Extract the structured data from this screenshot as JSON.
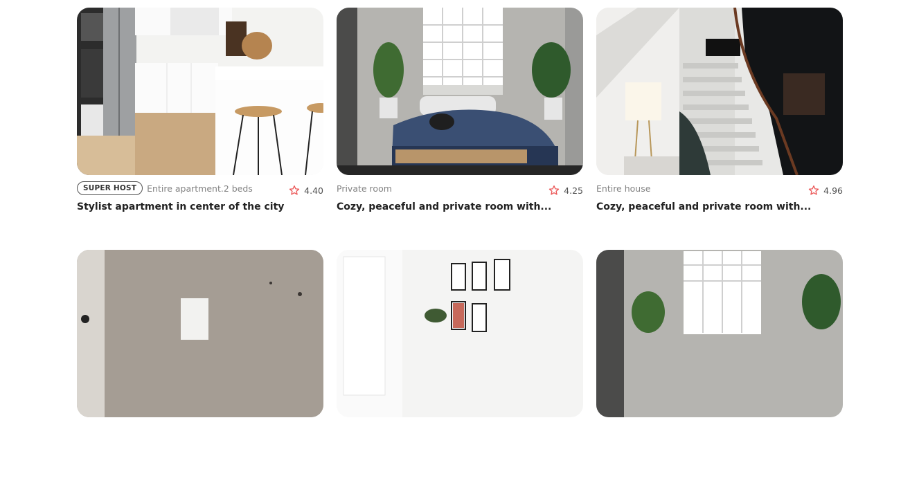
{
  "listings": [
    {
      "badge": "SUPER HOST",
      "type": "Entire apartment.2 beds",
      "rating": "4.40",
      "title": "Stylist apartment in center of the city",
      "image": "kitchen-photo"
    },
    {
      "badge": "",
      "type": "Private room",
      "rating": "4.25",
      "title": "Cozy, peaceful and private room with...",
      "image": "bedroom-photo"
    },
    {
      "badge": "",
      "type": "Entire house",
      "rating": "4.96",
      "title": "Cozy, peaceful and private room with...",
      "image": "staircase-photo"
    },
    {
      "image": "concrete-wall-photo"
    },
    {
      "image": "frames-wall-photo"
    },
    {
      "image": "bedroom-window-photo"
    }
  ],
  "colors": {
    "star": "#EB5757",
    "badge_border": "#4F4F4F",
    "muted": "#828282",
    "title": "#333333"
  }
}
